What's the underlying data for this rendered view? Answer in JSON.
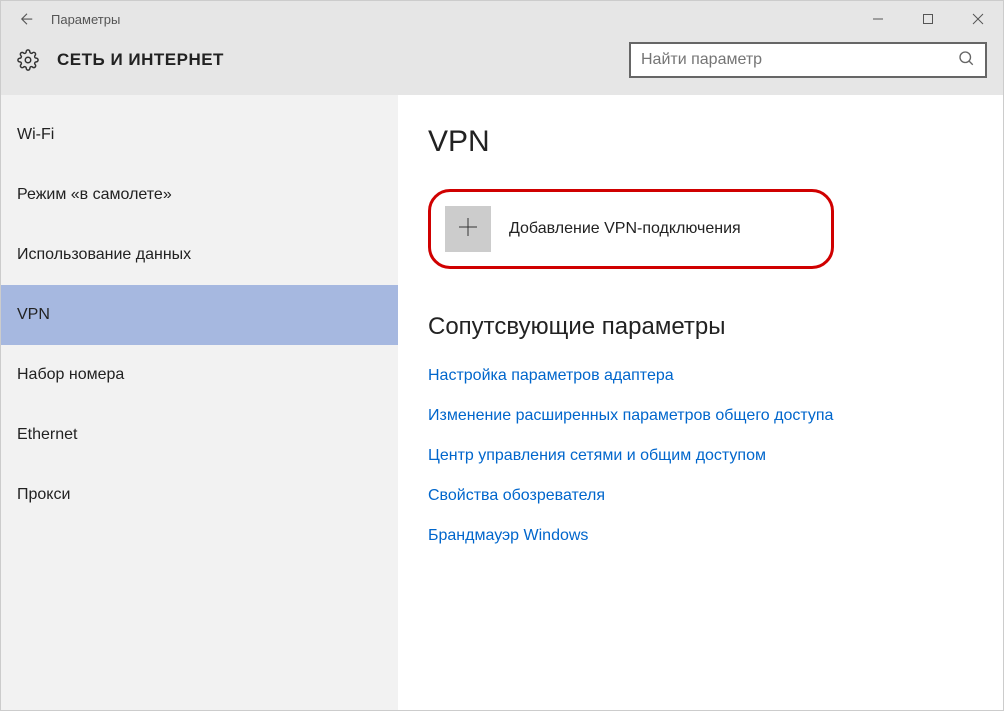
{
  "app_title": "Параметры",
  "header_title": "СЕТЬ И ИНТЕРНЕТ",
  "search_placeholder": "Найти параметр",
  "sidebar": {
    "items": [
      {
        "label": "Wi-Fi"
      },
      {
        "label": "Режим «в самолете»"
      },
      {
        "label": "Использование данных"
      },
      {
        "label": "VPN"
      },
      {
        "label": "Набор номера"
      },
      {
        "label": "Ethernet"
      },
      {
        "label": "Прокси"
      }
    ]
  },
  "main": {
    "page_title": "VPN",
    "add_connection_label": "Добавление VPN-подключения",
    "related_title": "Сопутсвующие параметры",
    "links": [
      {
        "label": "Настройка параметров адаптера"
      },
      {
        "label": "Изменение расширенных параметров общего доступа"
      },
      {
        "label": "Центр управления сетями и общим доступом"
      },
      {
        "label": "Свойства обозревателя"
      },
      {
        "label": "Брандмауэр Windows"
      }
    ]
  }
}
